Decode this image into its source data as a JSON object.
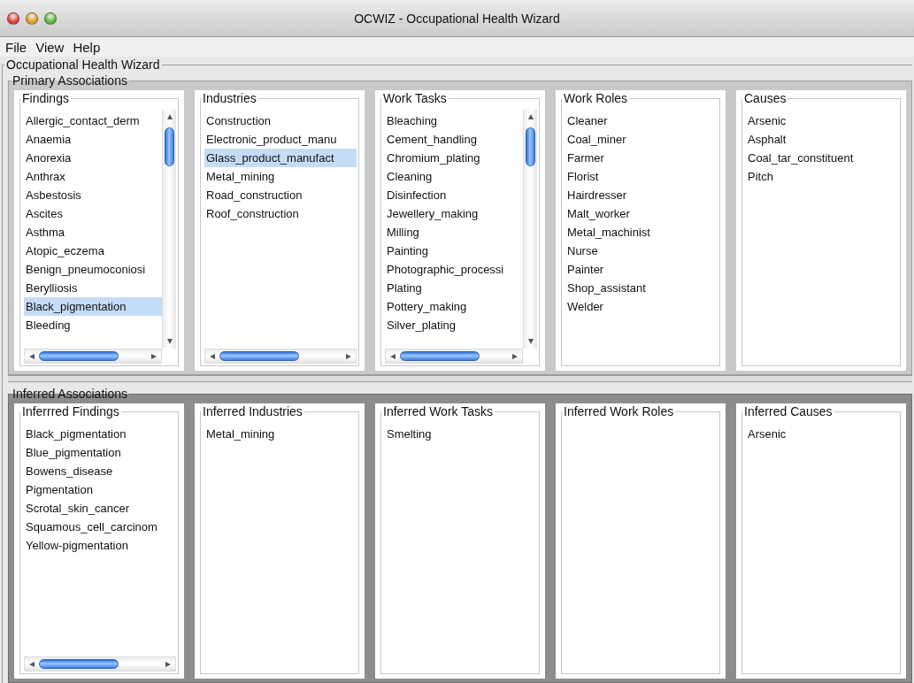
{
  "window": {
    "title": "OCWIZ - Occupational Health Wizard"
  },
  "menu": [
    {
      "label": "File"
    },
    {
      "label": "View"
    },
    {
      "label": "Help"
    }
  ],
  "wizard": {
    "title": "Occupational Health Wizard",
    "sections": [
      {
        "kind": "primary",
        "title": "Primary Associations",
        "panels": [
          {
            "title": "Findings",
            "vscroll": true,
            "hscroll": true,
            "items": [
              {
                "label": "Allergic_contact_derm",
                "selected": false
              },
              {
                "label": "Anaemia",
                "selected": false
              },
              {
                "label": "Anorexia",
                "selected": false
              },
              {
                "label": "Anthrax",
                "selected": false
              },
              {
                "label": "Asbestosis",
                "selected": false
              },
              {
                "label": "Ascites",
                "selected": false
              },
              {
                "label": "Asthma",
                "selected": false
              },
              {
                "label": "Atopic_eczema",
                "selected": false
              },
              {
                "label": "Benign_pneumoconiosi",
                "selected": false
              },
              {
                "label": "Berylliosis",
                "selected": false
              },
              {
                "label": "Black_pigmentation",
                "selected": true
              },
              {
                "label": "Bleeding",
                "selected": false
              }
            ]
          },
          {
            "title": "Industries",
            "vscroll": false,
            "hscroll": true,
            "items": [
              {
                "label": "Construction",
                "selected": false
              },
              {
                "label": "Electronic_product_manu",
                "selected": false
              },
              {
                "label": "Glass_product_manufact",
                "selected": true
              },
              {
                "label": "Metal_mining",
                "selected": false
              },
              {
                "label": "Road_construction",
                "selected": false
              },
              {
                "label": "Roof_construction",
                "selected": false
              }
            ]
          },
          {
            "title": "Work Tasks",
            "vscroll": true,
            "hscroll": true,
            "items": [
              {
                "label": "Bleaching",
                "selected": false
              },
              {
                "label": "Cement_handling",
                "selected": false
              },
              {
                "label": "Chromium_plating",
                "selected": false
              },
              {
                "label": "Cleaning",
                "selected": false
              },
              {
                "label": "Disinfection",
                "selected": false
              },
              {
                "label": "Jewellery_making",
                "selected": false
              },
              {
                "label": "Milling",
                "selected": false
              },
              {
                "label": "Painting",
                "selected": false
              },
              {
                "label": "Photographic_processi",
                "selected": false
              },
              {
                "label": "Plating",
                "selected": false
              },
              {
                "label": "Pottery_making",
                "selected": false
              },
              {
                "label": "Silver_plating",
                "selected": false
              }
            ]
          },
          {
            "title": "Work Roles",
            "vscroll": false,
            "hscroll": false,
            "items": [
              {
                "label": "Cleaner",
                "selected": false
              },
              {
                "label": "Coal_miner",
                "selected": false
              },
              {
                "label": "Farmer",
                "selected": false
              },
              {
                "label": "Florist",
                "selected": false
              },
              {
                "label": "Hairdresser",
                "selected": false
              },
              {
                "label": "Malt_worker",
                "selected": false
              },
              {
                "label": "Metal_machinist",
                "selected": false
              },
              {
                "label": "Nurse",
                "selected": false
              },
              {
                "label": "Painter",
                "selected": false
              },
              {
                "label": "Shop_assistant",
                "selected": false
              },
              {
                "label": "Welder",
                "selected": false
              }
            ]
          },
          {
            "title": "Causes",
            "vscroll": false,
            "hscroll": false,
            "items": [
              {
                "label": "Arsenic",
                "selected": false
              },
              {
                "label": "Asphalt",
                "selected": false
              },
              {
                "label": "Coal_tar_constituent",
                "selected": false
              },
              {
                "label": "Pitch",
                "selected": false
              }
            ]
          }
        ]
      },
      {
        "kind": "inferred",
        "title": "Inferred Associations",
        "panels": [
          {
            "title": "Inferrred Findings",
            "vscroll": false,
            "hscroll": true,
            "items": [
              {
                "label": "Black_pigmentation",
                "selected": false
              },
              {
                "label": "Blue_pigmentation",
                "selected": false
              },
              {
                "label": "Bowens_disease",
                "selected": false
              },
              {
                "label": "Pigmentation",
                "selected": false
              },
              {
                "label": "Scrotal_skin_cancer",
                "selected": false
              },
              {
                "label": "Squamous_cell_carcinom",
                "selected": false
              },
              {
                "label": "Yellow-pigmentation",
                "selected": false
              }
            ]
          },
          {
            "title": "Inferred Industries",
            "vscroll": false,
            "hscroll": false,
            "items": [
              {
                "label": "Metal_mining",
                "selected": false
              }
            ]
          },
          {
            "title": "Inferred Work Tasks",
            "vscroll": false,
            "hscroll": false,
            "items": [
              {
                "label": "Smelting",
                "selected": false
              }
            ]
          },
          {
            "title": "Inferred Work Roles",
            "vscroll": false,
            "hscroll": false
          },
          {
            "title": "Inferred Causes",
            "vscroll": false,
            "hscroll": false,
            "items": [
              {
                "label": "Arsenic",
                "selected": false
              }
            ]
          }
        ]
      }
    ]
  }
}
